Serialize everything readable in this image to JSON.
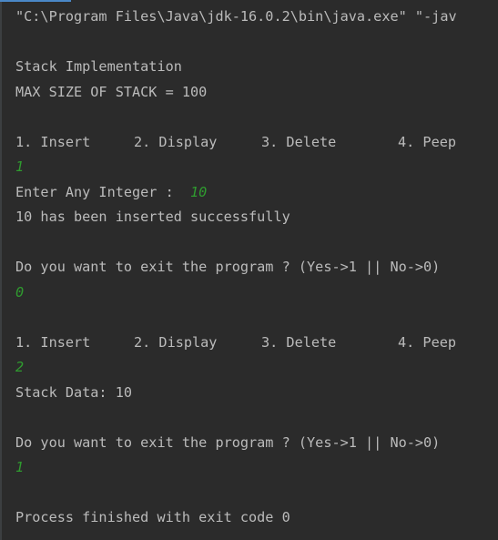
{
  "console": {
    "command": "\"C:\\Program Files\\Java\\jdk-16.0.2\\bin\\java.exe\" \"-jav",
    "title": "Stack Implementation",
    "max_size": "MAX SIZE OF STACK = 100",
    "menu": {
      "insert": "1. Insert",
      "display": "2. Display",
      "delete": "3. Delete",
      "peep": "4. Peep"
    },
    "choice_1": "1",
    "enter_prompt": "Enter Any Integer :  ",
    "entered_value": "10",
    "inserted_msg": "10 has been inserted successfully",
    "exit_prompt": "Do you want to exit the program ? (Yes->1 || No->0)",
    "exit_answer_1": "0",
    "choice_2": "2",
    "stack_data": "Stack Data: 10",
    "exit_answer_2": "1",
    "process_finished": "Process finished with exit code 0"
  }
}
